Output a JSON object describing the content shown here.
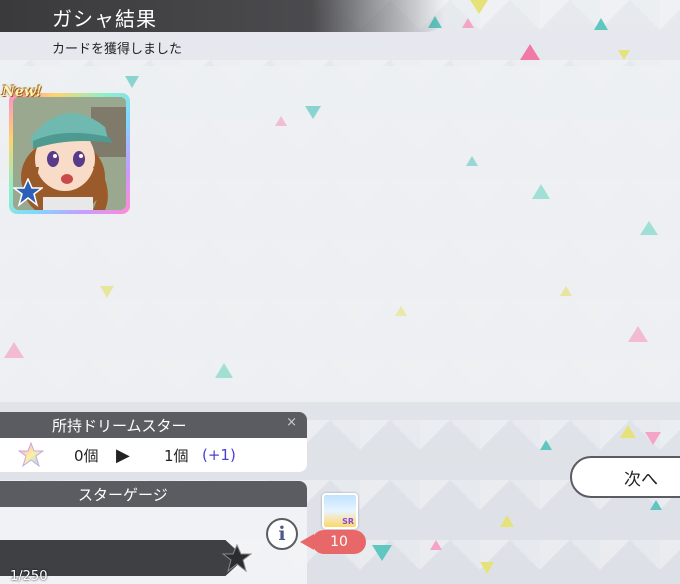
{
  "header": {
    "title": "ガシャ結果",
    "subtitle": "カードを獲得しました"
  },
  "card": {
    "badge": "New!",
    "accent": "#2d5fb8"
  },
  "dream_stars": {
    "title": "所持ドリームスター",
    "close_glyph": "×",
    "before": "0個",
    "arrow": "▶",
    "after": "1個",
    "delta": "(+1)",
    "delta_color": "#4b3fd6"
  },
  "star_gauge": {
    "title": "スターゲージ",
    "progress_text": "1/250",
    "progress_fraction": 0.004
  },
  "ticket": {
    "rarity": "SR",
    "count": "10"
  },
  "buttons": {
    "info_glyph": "i",
    "next_label": "次へ"
  }
}
